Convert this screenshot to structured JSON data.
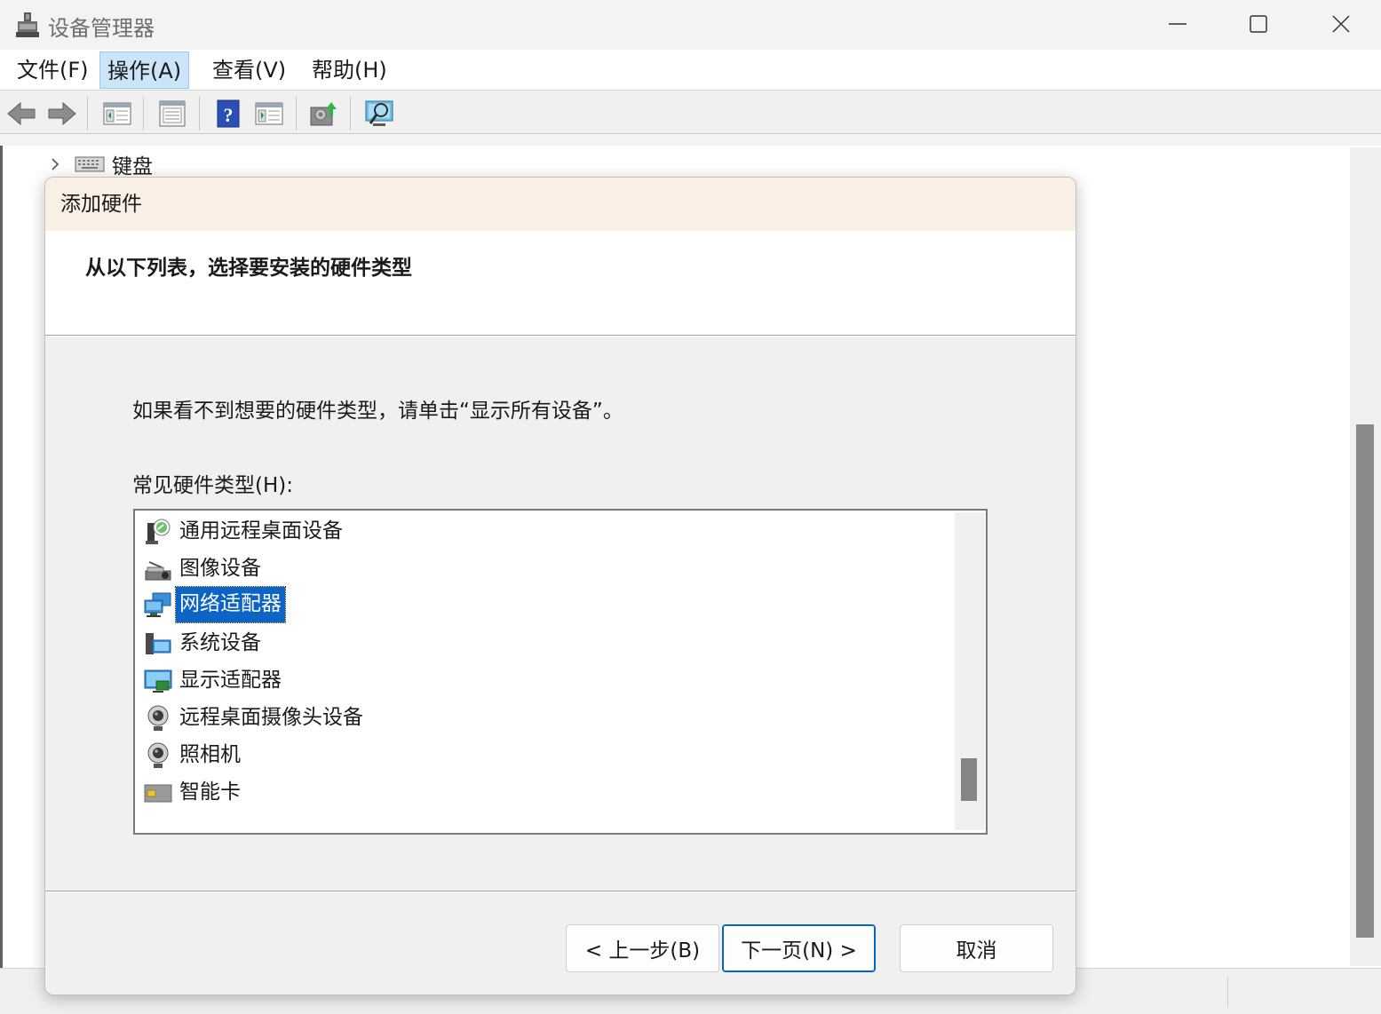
{
  "window": {
    "title": "设备管理器",
    "controls": {
      "minimize": "minimize-icon",
      "maximize": "maximize-icon",
      "close": "close-icon"
    }
  },
  "menubar": {
    "items": [
      {
        "label": "文件(F)"
      },
      {
        "label": "操作(A)",
        "active": true
      },
      {
        "label": "查看(V)"
      },
      {
        "label": "帮助(H)"
      }
    ]
  },
  "toolbar": {
    "buttons": [
      "back-arrow-icon",
      "forward-arrow-icon",
      "show-hide-console-tree-icon",
      "properties-icon",
      "help-icon",
      "action-pane-icon",
      "update-driver-icon",
      "scan-hardware-icon"
    ]
  },
  "tree": {
    "visible_node": {
      "label": "键盘",
      "icon": "keyboard-icon",
      "expanded": false
    }
  },
  "dialog": {
    "title": "添加硬件",
    "heading": "从以下列表，选择要安装的硬件类型",
    "info": "如果看不到想要的硬件类型，请单击“显示所有设备”。",
    "list_label": "常见硬件类型(H):",
    "list_items": [
      {
        "label": "通用远程桌面设备",
        "icon": "remote-desktop-device-icon"
      },
      {
        "label": "图像设备",
        "icon": "imaging-device-icon"
      },
      {
        "label": "网络适配器",
        "icon": "network-adapter-icon",
        "selected": true
      },
      {
        "label": "系统设备",
        "icon": "system-device-icon"
      },
      {
        "label": "显示适配器",
        "icon": "display-adapter-icon"
      },
      {
        "label": "远程桌面摄像头设备",
        "icon": "webcam-icon"
      },
      {
        "label": "照相机",
        "icon": "camera-icon"
      },
      {
        "label": "智能卡",
        "icon": "smart-card-icon"
      }
    ],
    "buttons": {
      "back": "< 上一步(B)",
      "next": "下一页(N) >",
      "cancel": "取消"
    }
  },
  "colors": {
    "selection": "#0c64c6",
    "dialog_title_bg": "#f9efe4",
    "menu_active_bg": "#cce4f7"
  }
}
